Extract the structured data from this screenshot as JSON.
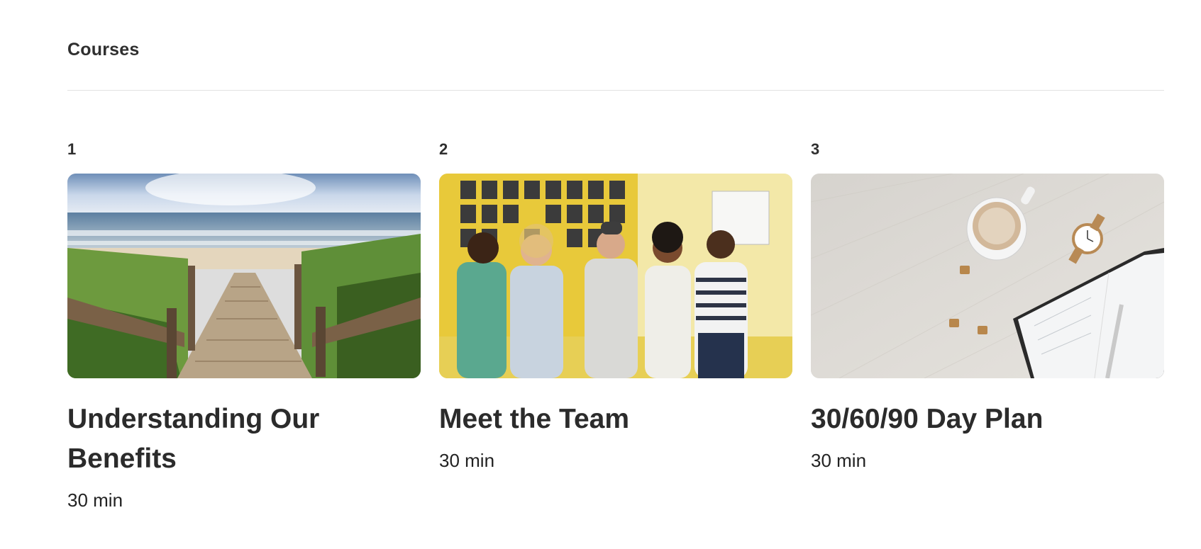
{
  "section": {
    "title": "Courses"
  },
  "courses": [
    {
      "index": "1",
      "title": "Understanding Our Benefits",
      "duration": "30 min",
      "image": "beach-boardwalk-image"
    },
    {
      "index": "2",
      "title": "Meet the Team",
      "duration": "30 min",
      "image": "team-group-photo-image"
    },
    {
      "index": "3",
      "title": "30/60/90 Day Plan",
      "duration": "30 min",
      "image": "desk-coffee-planner-image"
    }
  ]
}
